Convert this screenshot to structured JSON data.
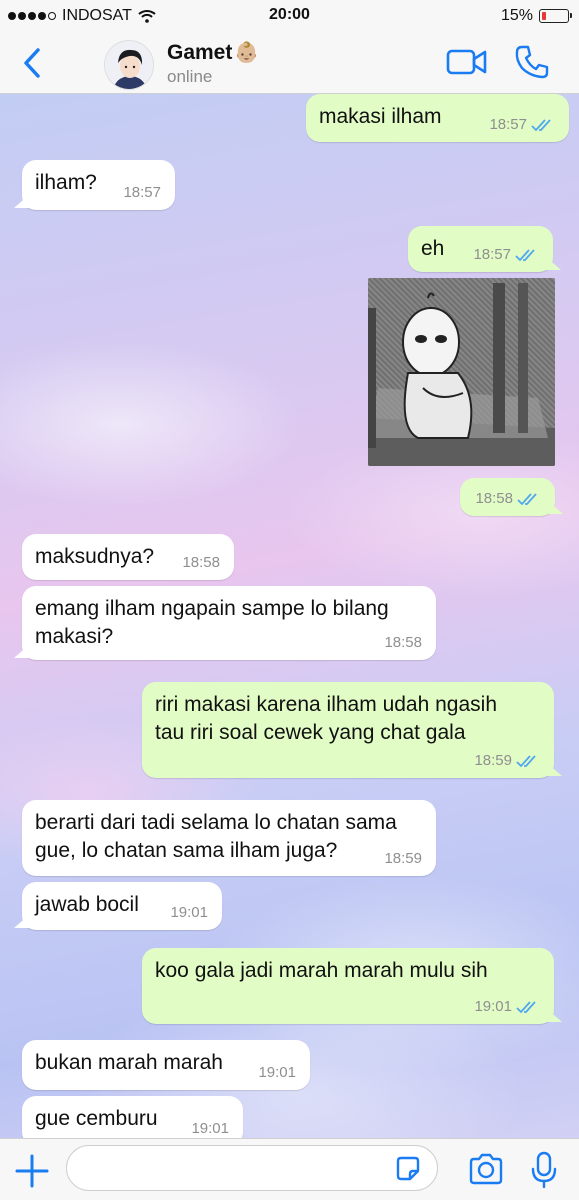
{
  "status_bar": {
    "carrier": "INDOSAT",
    "time": "20:00",
    "battery_percent": "15%",
    "battery_level": 0.15
  },
  "header": {
    "contact_name": "Gamet",
    "contact_emoji": "👶🏼",
    "contact_status": "online"
  },
  "messages": [
    {
      "direction": "out",
      "text": "makasi ilham",
      "time": "18:57",
      "read": true
    },
    {
      "direction": "in",
      "text": "ilham?",
      "time": "18:57"
    },
    {
      "direction": "out",
      "text": "eh",
      "time": "18:57",
      "read": true
    },
    {
      "direction": "out",
      "type": "sticker",
      "sticker": "sad-cartoon-sitting-on-bench",
      "time": "18:58",
      "read": true
    },
    {
      "direction": "in",
      "text": "maksudnya?",
      "time": "18:58"
    },
    {
      "direction": "in",
      "lines": [
        "emang ilham ngapain sampe lo bilang",
        "makasi?"
      ],
      "time": "18:58"
    },
    {
      "direction": "out",
      "lines": [
        "riri makasi karena ilham udah ngasih",
        "tau riri soal cewek yang chat gala"
      ],
      "time": "18:59",
      "read": true
    },
    {
      "direction": "in",
      "lines": [
        "berarti dari tadi selama lo chatan sama",
        "gue, lo chatan sama ilham juga?"
      ],
      "time": "18:59"
    },
    {
      "direction": "in",
      "text": "jawab bocil",
      "time": "19:01"
    },
    {
      "direction": "out",
      "text": "koo gala jadi marah marah mulu sih",
      "time": "19:01",
      "read": true
    },
    {
      "direction": "in",
      "text": "bukan marah marah",
      "time": "19:01"
    },
    {
      "direction": "in",
      "text": "gue cemburu",
      "time": "19:01"
    }
  ],
  "composer": {
    "value": "",
    "placeholder": ""
  },
  "colors": {
    "accent": "#1a7cf2",
    "outgoing_bubble": "#e2fcc6",
    "incoming_bubble": "#ffffff",
    "read_ticks": "#4fa8ef",
    "battery_low": "#e53935"
  }
}
